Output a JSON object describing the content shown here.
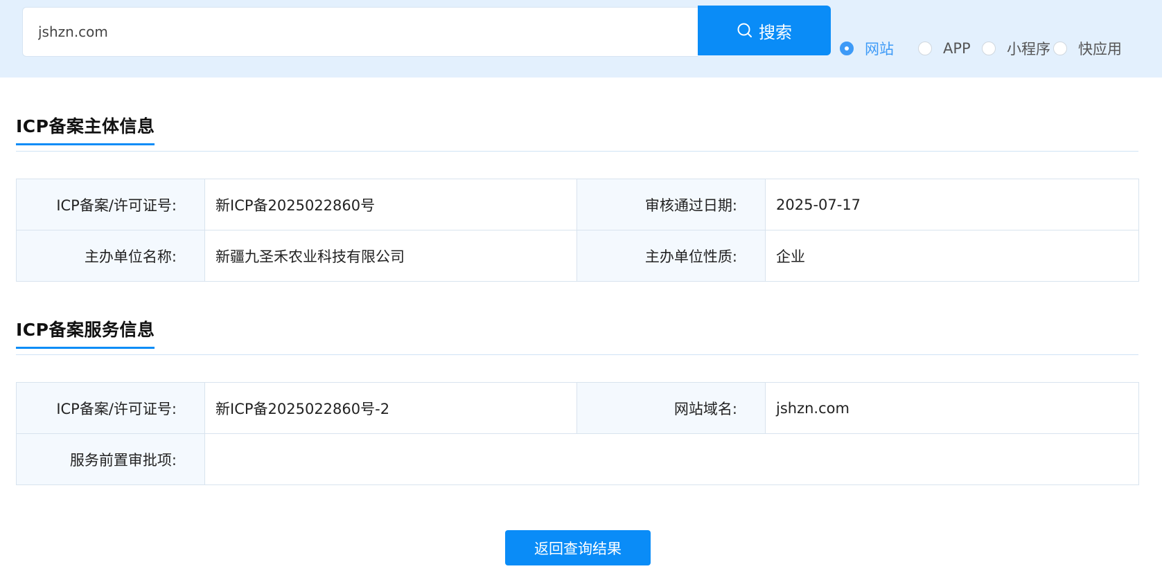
{
  "search": {
    "value": "jshzn.com",
    "button_label": "搜索"
  },
  "radio_options": [
    {
      "label": "网站",
      "checked": true
    },
    {
      "label": "APP",
      "checked": false
    },
    {
      "label": "小程序",
      "checked": false
    },
    {
      "label": "快应用",
      "checked": false
    }
  ],
  "subject_section": {
    "title": "ICP备案主体信息",
    "rows": [
      {
        "key1": "ICP备案/许可证号:",
        "val1": "新ICP备2025022860号",
        "key2": "审核通过日期:",
        "val2": "2025-07-17"
      },
      {
        "key1": "主办单位名称:",
        "val1": "新疆九圣禾农业科技有限公司",
        "key2": "主办单位性质:",
        "val2": "企业"
      }
    ]
  },
  "service_section": {
    "title": "ICP备案服务信息",
    "row1": {
      "key1": "ICP备案/许可证号:",
      "val1": "新ICP备2025022860号-2",
      "key2": "网站域名:",
      "val2": "jshzn.com"
    },
    "row2": {
      "key1": "服务前置审批项:",
      "val1": ""
    }
  },
  "back_button_label": "返回查询结果",
  "colors": {
    "accent": "#0a8cf7",
    "topbar_bg": "#e3f0fd",
    "key_cell_bg": "#f4f9fe"
  }
}
